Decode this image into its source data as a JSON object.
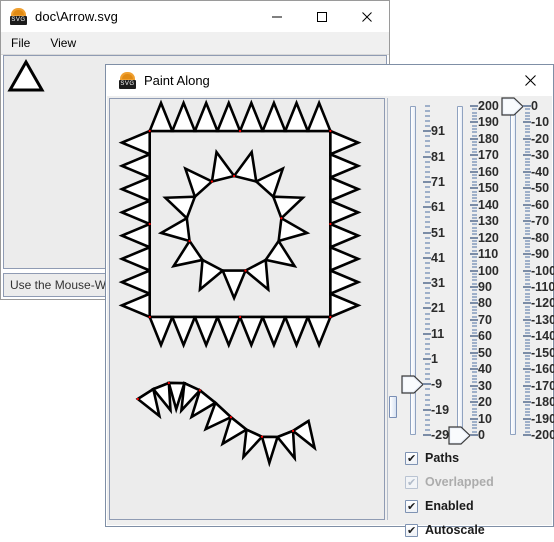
{
  "background_window": {
    "title": "doc\\Arrow.svg",
    "icon": "svg-app-icon",
    "plate_text": "SVG",
    "menu": [
      {
        "label": "File"
      },
      {
        "label": "View"
      }
    ],
    "window_buttons": [
      {
        "name": "minimize",
        "glyph": "minimize-icon"
      },
      {
        "name": "maximize",
        "glyph": "maximize-icon"
      },
      {
        "name": "close",
        "glyph": "close-icon"
      }
    ],
    "status_text": "Use the Mouse-W"
  },
  "foreground_window": {
    "title": "Paint Along",
    "icon": "svg-app-icon",
    "plate_text": "SVG",
    "close_label": "close-icon",
    "canvas": {
      "name": "paint-canvas",
      "shapes": [
        "spiked-square",
        "spiked-circle",
        "spiked-wave"
      ],
      "stroke_color": "#000000",
      "fill_color": "#ffffff",
      "marker_color": "#ff0000",
      "background_color": "#ececec"
    },
    "sliders": [
      {
        "name": "slider-one",
        "min": -29,
        "max": 101,
        "value": -9,
        "step": 10,
        "labels": [
          "91",
          "81",
          "71",
          "61",
          "51",
          "41",
          "31",
          "21",
          "11",
          "1",
          "-9",
          "-19",
          "-29"
        ],
        "label_values": [
          91,
          81,
          71,
          61,
          51,
          41,
          31,
          21,
          11,
          1,
          -9,
          -19,
          -29
        ]
      },
      {
        "name": "slider-two",
        "min": 0,
        "max": 200,
        "value": 0,
        "step": 10,
        "labels": [
          "200",
          "190",
          "180",
          "170",
          "160",
          "150",
          "140",
          "130",
          "120",
          "110",
          "100",
          "90",
          "80",
          "70",
          "60",
          "50",
          "40",
          "30",
          "20",
          "10",
          "0"
        ],
        "label_values": [
          200,
          190,
          180,
          170,
          160,
          150,
          140,
          130,
          120,
          110,
          100,
          90,
          80,
          70,
          60,
          50,
          40,
          30,
          20,
          10,
          0
        ]
      },
      {
        "name": "slider-three",
        "min": -200,
        "max": 0,
        "value": 0,
        "step": 10,
        "labels": [
          "0",
          "-10",
          "-20",
          "-30",
          "-40",
          "-50",
          "-60",
          "-70",
          "-80",
          "-90",
          "-100",
          "-110",
          "-120",
          "-130",
          "-140",
          "-150",
          "-160",
          "-170",
          "-180",
          "-190",
          "-200"
        ],
        "label_values": [
          0,
          -10,
          -20,
          -30,
          -40,
          -50,
          -60,
          -70,
          -80,
          -90,
          -100,
          -110,
          -120,
          -130,
          -140,
          -150,
          -160,
          -170,
          -180,
          -190,
          -200
        ]
      }
    ],
    "checkboxes": [
      {
        "name": "checkbox-paths",
        "label": "Paths",
        "checked": true,
        "disabled": false
      },
      {
        "name": "checkbox-overlapped",
        "label": "Overlapped",
        "checked": true,
        "disabled": true
      },
      {
        "name": "checkbox-enabled",
        "label": "Enabled",
        "checked": true,
        "disabled": false
      },
      {
        "name": "checkbox-autoscale",
        "label": "Autoscale",
        "checked": true,
        "disabled": false
      }
    ],
    "splitter": {
      "name": "split-pane-divider"
    }
  },
  "colors": {
    "window_bg": "#ffffff",
    "panel_bg": "#efefef",
    "canvas_bg": "#ececec",
    "border": "#8f9bb3",
    "slider_accent": "#7b8ca6",
    "tick_label": "#2b2b2b",
    "disabled_text": "#acacac"
  }
}
